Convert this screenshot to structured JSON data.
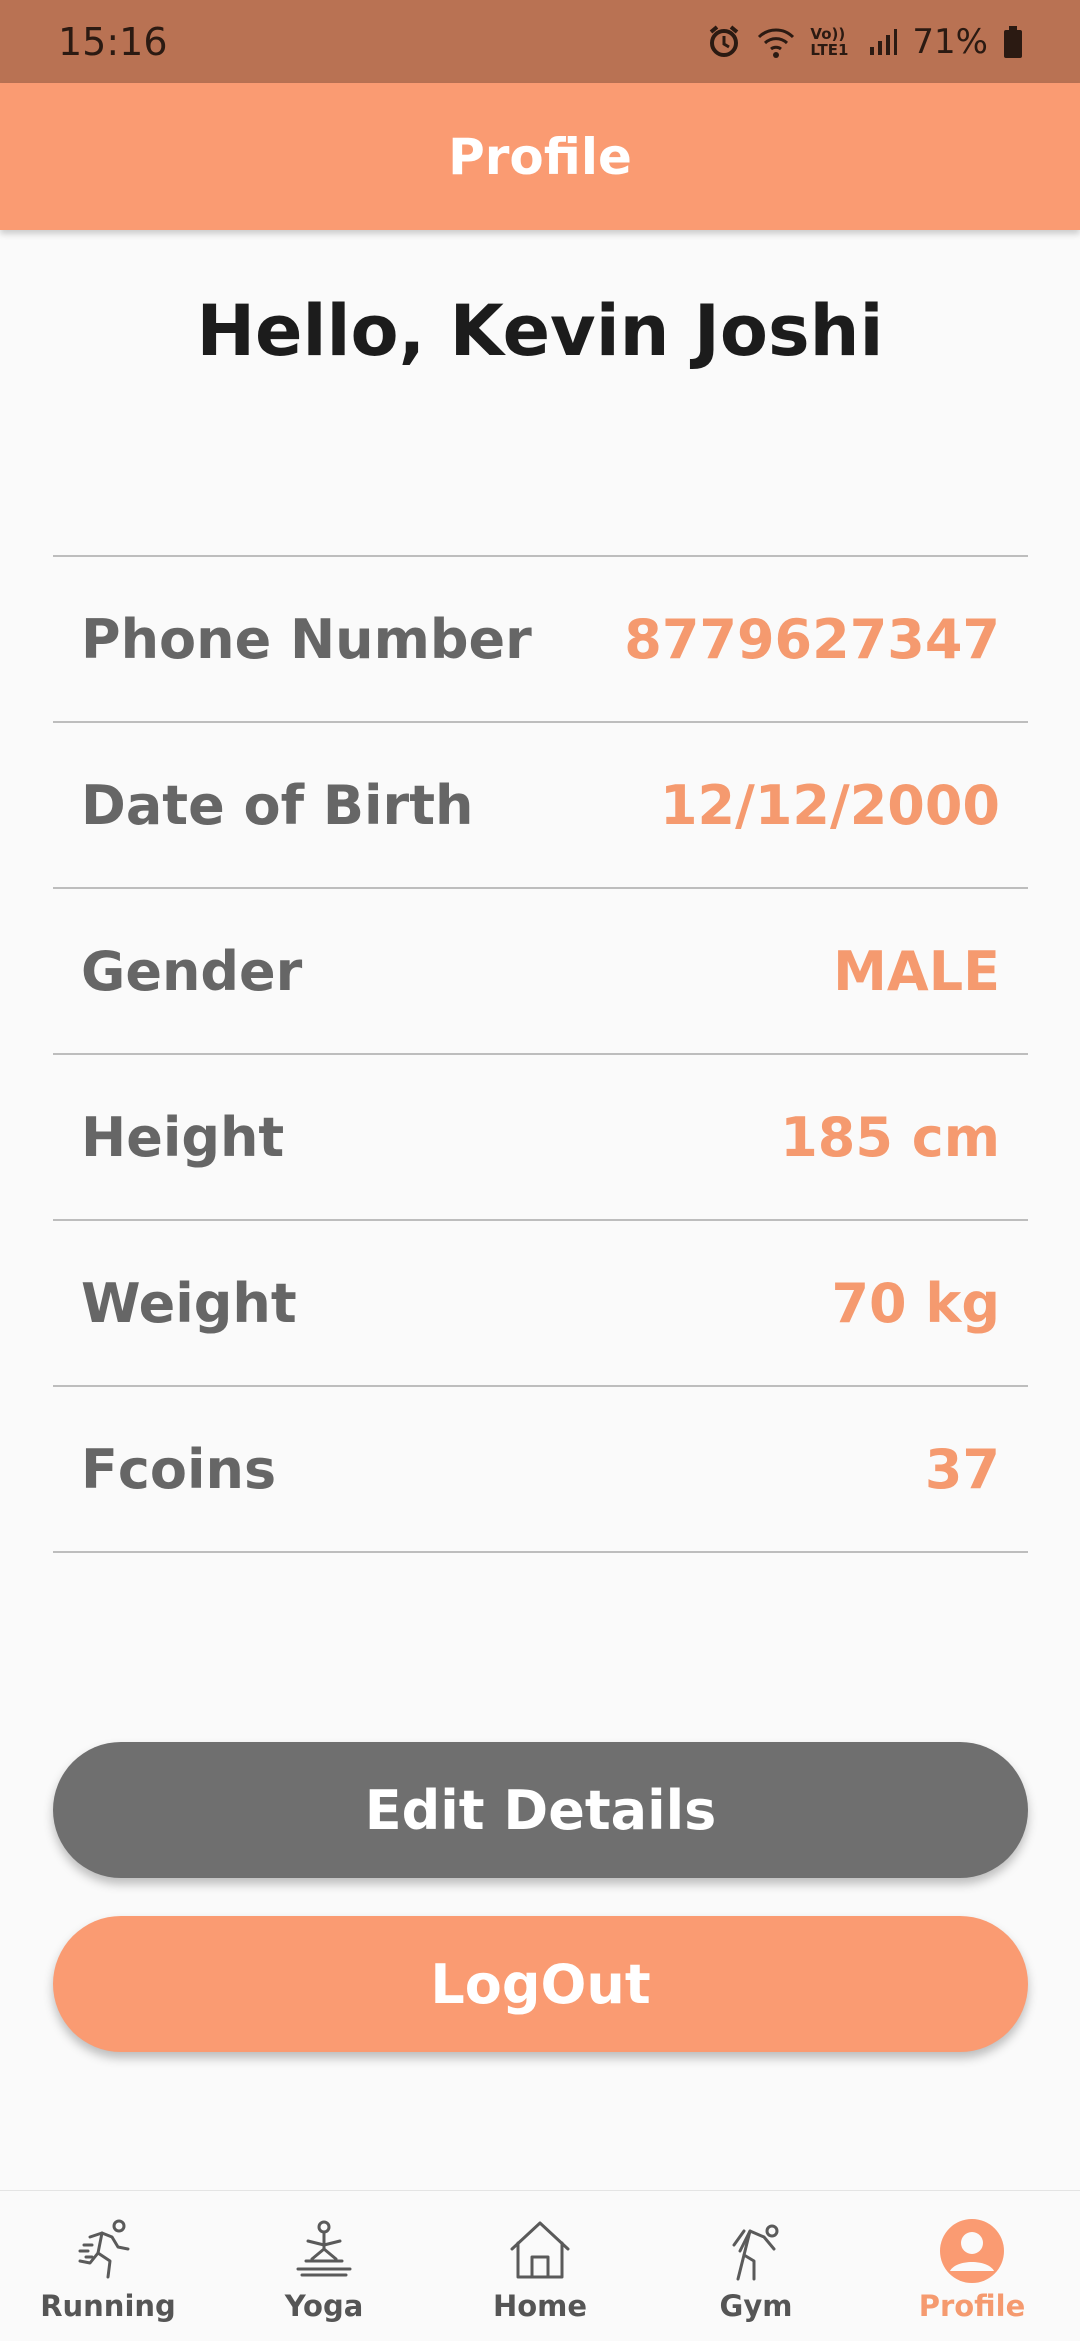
{
  "status_bar": {
    "time": "15:16",
    "battery_text": "71%",
    "network_text": "Vo)) LTE1",
    "icons": [
      "alarm-icon",
      "wifi-icon",
      "signal-icon",
      "battery-icon"
    ]
  },
  "app_bar": {
    "title": "Profile"
  },
  "greeting": "Hello, Kevin Joshi",
  "info_rows": [
    {
      "label": "Phone Number",
      "value": "8779627347"
    },
    {
      "label": "Date of Birth",
      "value": "12/12/2000"
    },
    {
      "label": "Gender",
      "value": "MALE"
    },
    {
      "label": "Height",
      "value": "185 cm"
    },
    {
      "label": "Weight",
      "value": "70 kg"
    },
    {
      "label": "Fcoins",
      "value": "37"
    }
  ],
  "buttons": {
    "edit_label": "Edit Details",
    "logout_label": "LogOut"
  },
  "bottom_nav": {
    "items": [
      {
        "label": "Running",
        "icon": "running-icon"
      },
      {
        "label": "Yoga",
        "icon": "yoga-icon"
      },
      {
        "label": "Home",
        "icon": "home-icon"
      },
      {
        "label": "Gym",
        "icon": "gym-icon"
      },
      {
        "label": "Profile",
        "icon": "profile-icon",
        "active": true
      }
    ]
  },
  "colors": {
    "accent": "#fa9b72",
    "status_bar": "#b97253",
    "value_text": "#f59a6f",
    "edit_button": "#6f6f6f",
    "label_text": "#666666"
  }
}
